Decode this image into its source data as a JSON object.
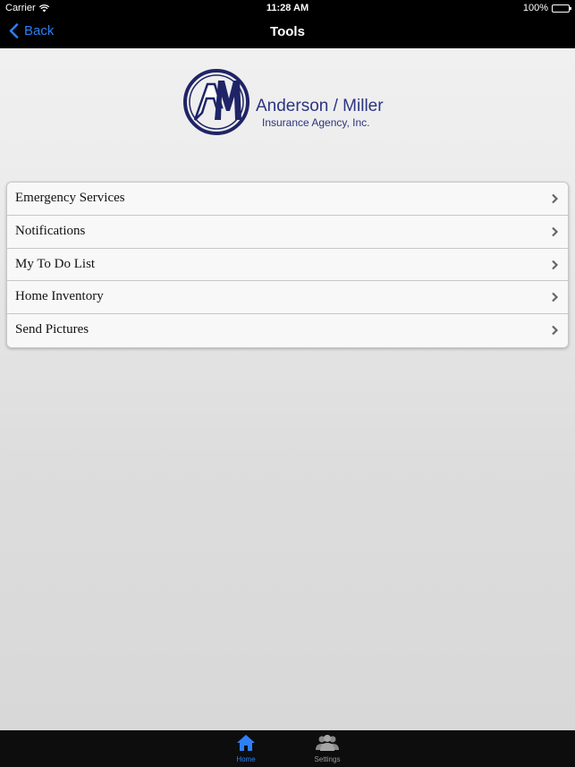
{
  "status_bar": {
    "carrier": "Carrier",
    "time": "11:28 AM",
    "battery": "100%"
  },
  "nav": {
    "back_label": "Back",
    "title": "Tools"
  },
  "logo": {
    "monogram": "AM",
    "company": "Anderson / Miller",
    "subtitle": "Insurance Agency, Inc."
  },
  "menu": {
    "items": [
      {
        "label": "Emergency Services"
      },
      {
        "label": "Notifications"
      },
      {
        "label": "My To Do List"
      },
      {
        "label": "Home Inventory"
      },
      {
        "label": "Send Pictures"
      }
    ]
  },
  "tab_bar": {
    "tabs": [
      {
        "label": "Home",
        "icon": "home-icon",
        "selected": true
      },
      {
        "label": "Settings",
        "icon": "users-icon",
        "selected": false
      }
    ]
  },
  "colors": {
    "accent": "#2a7ff2",
    "logo_navy": "#2c3480",
    "bar_background": "#000000"
  }
}
